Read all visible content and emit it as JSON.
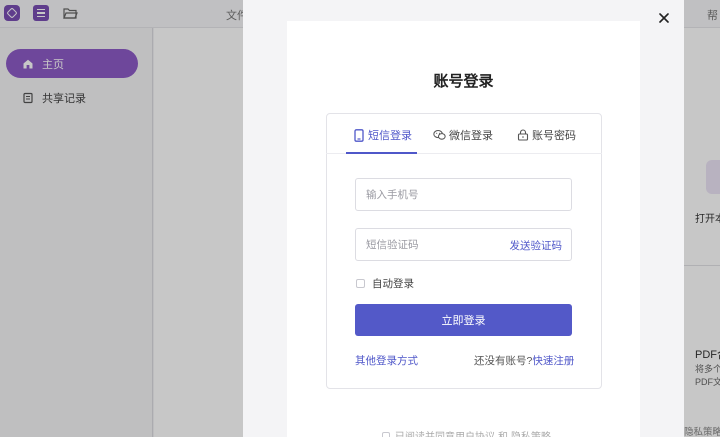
{
  "app": {
    "topbar": {
      "file_menu": "文件",
      "help_menu": "帮"
    },
    "sidebar": {
      "items": [
        {
          "label": "主页",
          "icon": "home-icon",
          "active": true
        },
        {
          "label": "共享记录",
          "icon": "share-record-icon",
          "active": false
        }
      ]
    },
    "right_peek": {
      "open_text": "打开本",
      "pdf_title": "PDF合",
      "pdf_line1": "将多个",
      "pdf_line2": "PDF文",
      "privacy": "隐私策略"
    }
  },
  "modal": {
    "title": "账号登录",
    "tabs": [
      {
        "label": "短信登录",
        "icon": "phone-icon",
        "active": true
      },
      {
        "label": "微信登录",
        "icon": "wechat-icon",
        "active": false
      },
      {
        "label": "账号密码",
        "icon": "lock-icon",
        "active": false
      }
    ],
    "phone_input": {
      "placeholder": "输入手机号",
      "value": ""
    },
    "code_input": {
      "placeholder": "短信验证码",
      "value": ""
    },
    "send_code_label": "发送验证码",
    "remember_label": "自动登录",
    "login_button": "立即登录",
    "other_login_label": "其他登录方式",
    "register_prompt": "还没有账号?",
    "register_link": "快速注册",
    "agreement": {
      "prefix": "已阅读并同意",
      "user_agreement": "用户协议",
      "and": "和",
      "privacy_policy": "隐私策略"
    }
  },
  "colors": {
    "accent": "#5359c8",
    "sidebar_active": "#8e5cc7",
    "brand": "#7a4fb4"
  }
}
